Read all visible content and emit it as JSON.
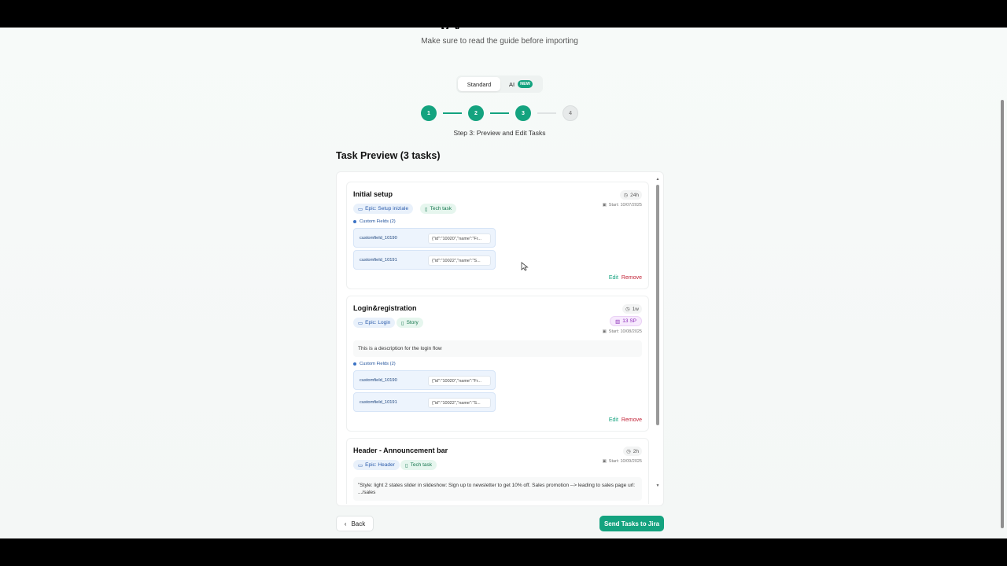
{
  "header": {
    "title_fragment": "p   y",
    "subtitle": "Make sure to read the guide before importing"
  },
  "mode_toggle": {
    "standard_label": "Standard",
    "ai_label": "AI",
    "new_badge": "NEW"
  },
  "stepper": {
    "steps": [
      "1",
      "2",
      "3",
      "4"
    ],
    "caption": "Step 3: Preview and Edit Tasks"
  },
  "preview": {
    "title": "Task Preview (3 tasks)",
    "tasks": [
      {
        "title": "Initial setup",
        "time": "24h",
        "start": "Start: 10/07/2025",
        "epic": "Epic: Setup iniziale",
        "type": "Tech task",
        "custom_fields_label": "Custom Fields (2)",
        "custom_fields": [
          {
            "key": "customfield_10190",
            "value": "{\"id\":\"10020\",\"name\":\"Fr..."
          },
          {
            "key": "customfield_10191",
            "value": "{\"id\":\"10022\",\"name\":\"S..."
          }
        ],
        "edit": "Edit",
        "remove": "Remove"
      },
      {
        "title": "Login&registration",
        "time": "1w",
        "story_points": "13 SP",
        "start": "Start: 10/08/2025",
        "epic": "Epic: Login",
        "type": "Story",
        "description": "This is a description for the login flow",
        "custom_fields_label": "Custom Fields (2)",
        "custom_fields": [
          {
            "key": "customfield_10190",
            "value": "{\"id\":\"10020\",\"name\":\"Fr..."
          },
          {
            "key": "customfield_10191",
            "value": "{\"id\":\"10022\",\"name\":\"S..."
          }
        ],
        "edit": "Edit",
        "remove": "Remove"
      },
      {
        "title": "Header - Announcement bar",
        "time": "2h",
        "start": "Start: 10/09/2025",
        "epic": "Epic: Header",
        "type": "Tech task",
        "description": "\"Style: light 2 states slider in slideshow: Sign up to newsletter to get 10% off. Sales promotion --> leading to sales page url: .../sales"
      }
    ]
  },
  "footer": {
    "back": "Back",
    "send": "Send Tasks to Jira"
  },
  "colors": {
    "accent": "#14a37f",
    "danger": "#c22236",
    "epic_blue": "#2b5bab"
  }
}
